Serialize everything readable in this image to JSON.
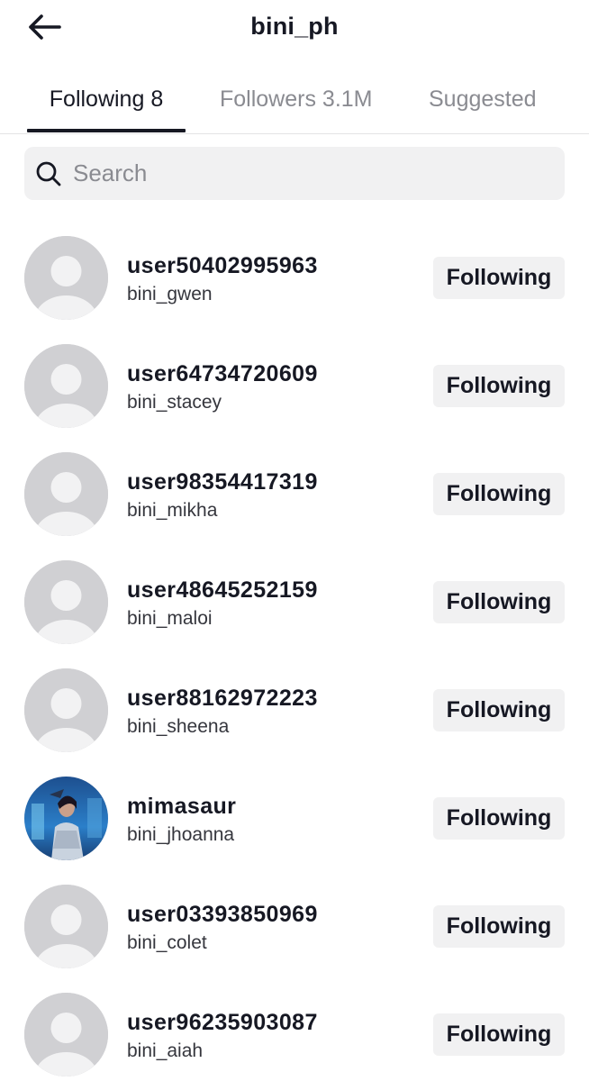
{
  "header": {
    "title": "bini_ph",
    "back_icon": "arrow-left-icon"
  },
  "tabs": [
    {
      "label": "Following 8",
      "active": true
    },
    {
      "label": "Followers 3.1M",
      "active": false
    },
    {
      "label": "Suggested",
      "active": false
    }
  ],
  "search": {
    "placeholder": "Search",
    "value": "",
    "icon": "search-icon"
  },
  "following": [
    {
      "username": "user50402995963",
      "nickname": "bini_gwen",
      "button": "Following",
      "avatar": "default-avatar"
    },
    {
      "username": "user64734720609",
      "nickname": "bini_stacey",
      "button": "Following",
      "avatar": "default-avatar"
    },
    {
      "username": "user98354417319",
      "nickname": "bini_mikha",
      "button": "Following",
      "avatar": "default-avatar"
    },
    {
      "username": "user48645252159",
      "nickname": "bini_maloi",
      "button": "Following",
      "avatar": "default-avatar"
    },
    {
      "username": "user88162972223",
      "nickname": "bini_sheena",
      "button": "Following",
      "avatar": "default-avatar"
    },
    {
      "username": "mimasaur",
      "nickname": "bini_jhoanna",
      "button": "Following",
      "avatar": "photo-avatar"
    },
    {
      "username": "user03393850969",
      "nickname": "bini_colet",
      "button": "Following",
      "avatar": "default-avatar"
    },
    {
      "username": "user96235903087",
      "nickname": "bini_aiah",
      "button": "Following",
      "avatar": "default-avatar"
    }
  ],
  "colors": {
    "text_primary": "#161823",
    "text_secondary": "#8a8b91",
    "surface": "#f1f1f2",
    "avatar_placeholder": "#d0d0d3"
  }
}
